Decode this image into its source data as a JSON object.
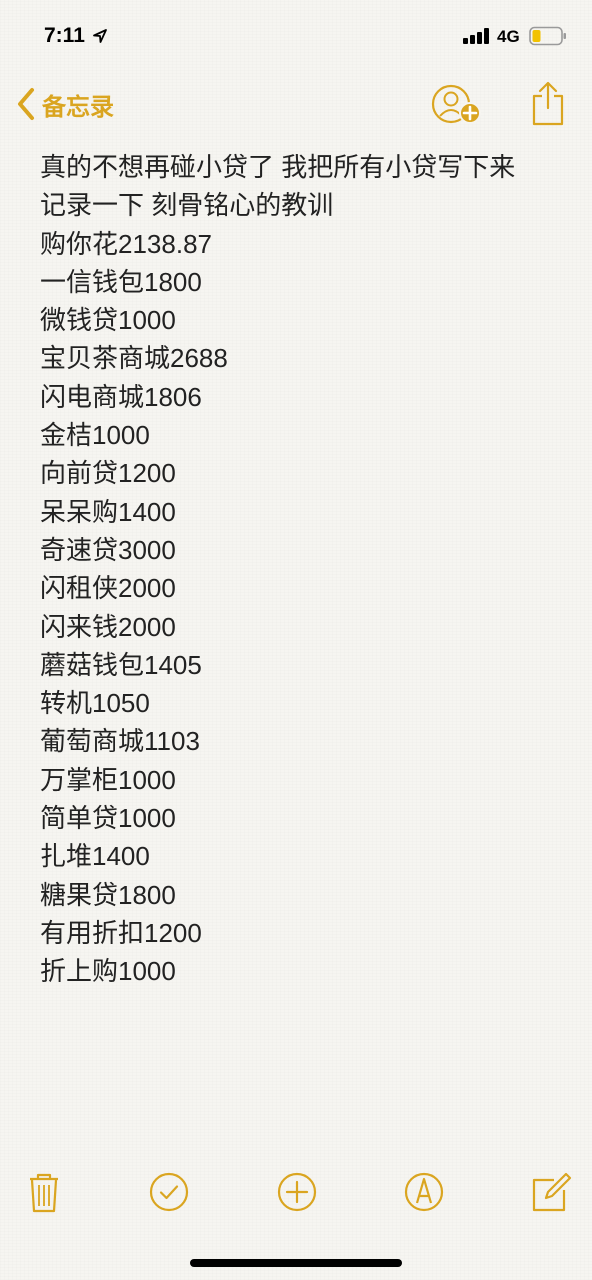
{
  "status_bar": {
    "time": "7:11",
    "network": "4G",
    "icons": [
      "location-arrow-icon",
      "signal-bars-icon",
      "battery-low-icon"
    ]
  },
  "nav": {
    "back_label": "备忘录",
    "icons": [
      "chevron-left-icon",
      "add-person-icon",
      "share-icon"
    ]
  },
  "note": {
    "lines": [
      "真的不想再碰小贷了 我把所有小贷写下来",
      "记录一下 刻骨铭心的教训",
      "购你花2138.87",
      "一信钱包1800",
      "微钱贷1000",
      "宝贝茶商城2688",
      "闪电商城1806",
      "金桔1000",
      "向前贷1200",
      "呆呆购1400",
      "奇速贷3000",
      "闪租侠2000",
      "闪来钱2000",
      "蘑菇钱包1405",
      "转机1050",
      "葡萄商城1103",
      "万掌柜1000",
      "简单贷1000",
      "扎堆1400",
      "糖果贷1800",
      "有用折扣1200",
      "折上购1000"
    ]
  },
  "toolbar": {
    "icons": [
      "trash-icon",
      "checklist-icon",
      "add-icon",
      "markup-icon",
      "compose-icon"
    ]
  },
  "colors": {
    "accent": "#daa520",
    "text": "#222222",
    "background": "#f6f5f1"
  }
}
